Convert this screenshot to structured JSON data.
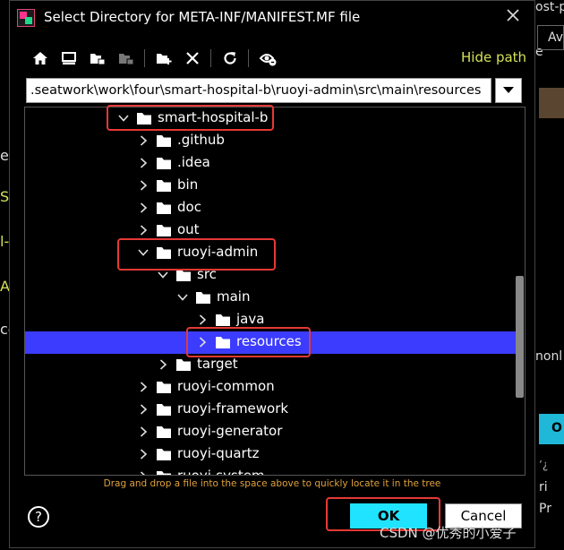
{
  "dialog": {
    "title": "Select Directory for META-INF/MANIFEST.MF file",
    "hide_path_label": "Hide path",
    "path_value": ".seatwork\\work\\four\\smart-hospital-b\\ruoyi-admin\\src\\main\\resources",
    "hint": "Drag and drop a file into the space above to quickly locate it in the tree",
    "help_label": "?",
    "ok_label": "OK",
    "cancel_label": "Cancel",
    "toolbar_icons": [
      "home-icon",
      "desktop-icon",
      "project-icon",
      "module-icon",
      "new-folder-icon",
      "delete-icon",
      "refresh-icon",
      "show-hidden-icon"
    ]
  },
  "tree": {
    "items": [
      {
        "label": "smart-hospital-b",
        "depth": 0,
        "expanded": true,
        "has_children": true,
        "selected": false
      },
      {
        "label": ".github",
        "depth": 1,
        "expanded": false,
        "has_children": true,
        "selected": false
      },
      {
        "label": ".idea",
        "depth": 1,
        "expanded": false,
        "has_children": true,
        "selected": false
      },
      {
        "label": "bin",
        "depth": 1,
        "expanded": false,
        "has_children": true,
        "selected": false
      },
      {
        "label": "doc",
        "depth": 1,
        "expanded": false,
        "has_children": true,
        "selected": false
      },
      {
        "label": "out",
        "depth": 1,
        "expanded": false,
        "has_children": true,
        "selected": false
      },
      {
        "label": "ruoyi-admin",
        "depth": 1,
        "expanded": true,
        "has_children": true,
        "selected": false
      },
      {
        "label": "src",
        "depth": 2,
        "expanded": true,
        "has_children": true,
        "selected": false
      },
      {
        "label": "main",
        "depth": 3,
        "expanded": true,
        "has_children": true,
        "selected": false
      },
      {
        "label": "java",
        "depth": 4,
        "expanded": false,
        "has_children": true,
        "selected": false
      },
      {
        "label": "resources",
        "depth": 4,
        "expanded": false,
        "has_children": true,
        "selected": true
      },
      {
        "label": "target",
        "depth": 2,
        "expanded": false,
        "has_children": true,
        "selected": false
      },
      {
        "label": "ruoyi-common",
        "depth": 1,
        "expanded": false,
        "has_children": true,
        "selected": false
      },
      {
        "label": "ruoyi-framework",
        "depth": 1,
        "expanded": false,
        "has_children": true,
        "selected": false
      },
      {
        "label": "ruoyi-generator",
        "depth": 1,
        "expanded": false,
        "has_children": true,
        "selected": false
      },
      {
        "label": "ruoyi-quartz",
        "depth": 1,
        "expanded": false,
        "has_children": true,
        "selected": false
      },
      {
        "label": "ruoyi-system",
        "depth": 1,
        "expanded": false,
        "has_children": true,
        "selected": false
      }
    ]
  },
  "background": {
    "right_tabs": [
      "ost-p",
      "e",
      "Av",
      "nonl",
      "O",
      "’¿",
      "ri",
      "Pr"
    ],
    "left_letters": [
      "e",
      "S",
      "l-",
      "A",
      "co"
    ]
  },
  "watermark": "CSDN @优秀的小爱子",
  "colors": {
    "selection": "#3c3cff",
    "ok_button": "#1fe3ff",
    "hide_path": "#d4e157",
    "hint": "#e0a23c",
    "highlight": "#e53935"
  }
}
